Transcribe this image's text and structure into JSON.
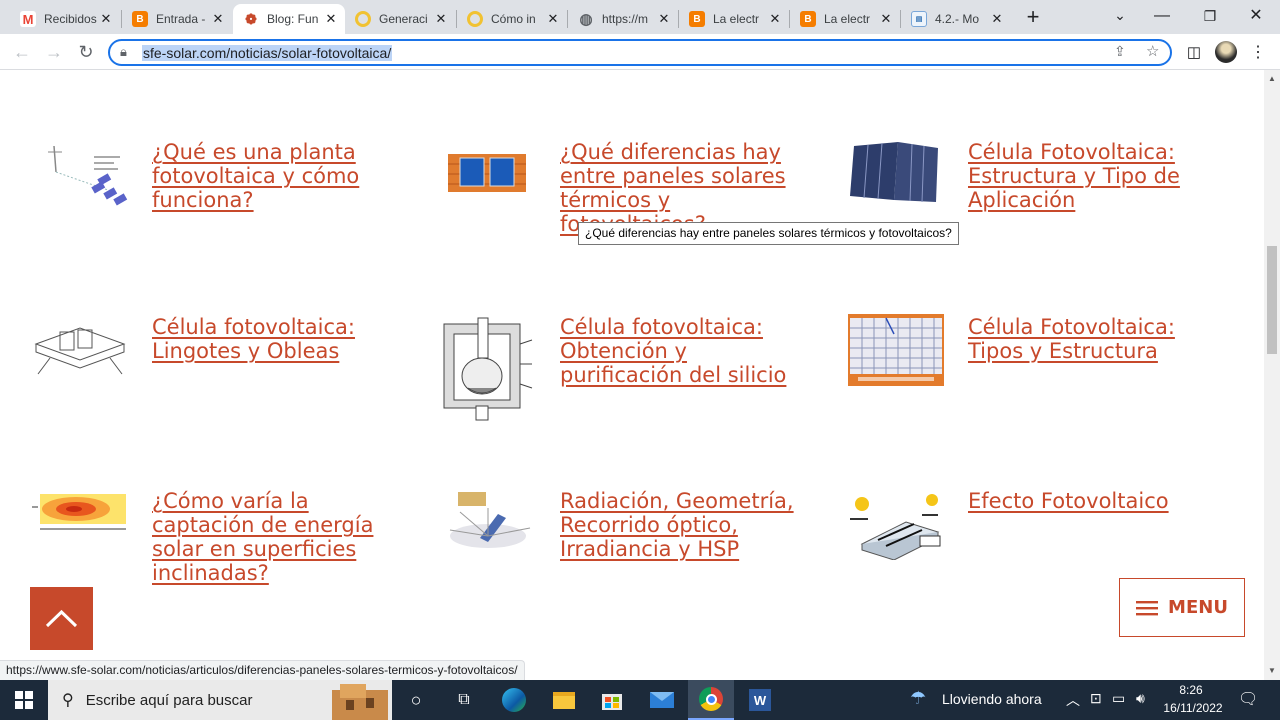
{
  "browser": {
    "tabs": [
      {
        "title": "Recibidos",
        "favicon": "gmail-icon",
        "active": false
      },
      {
        "title": "Entrada -",
        "favicon": "blogger-icon",
        "active": false
      },
      {
        "title": "Blog: Fun",
        "favicon": "sfe-solar-icon",
        "active": true
      },
      {
        "title": "Generaci",
        "favicon": "loading-icon",
        "active": false
      },
      {
        "title": "Cómo in",
        "favicon": "loading-icon",
        "active": false
      },
      {
        "title": "https://m",
        "favicon": "globe-icon",
        "active": false
      },
      {
        "title": "La electr",
        "favicon": "blogger-icon",
        "active": false
      },
      {
        "title": "La electr",
        "favicon": "blogger-icon",
        "active": false
      },
      {
        "title": "4.2.- Mo",
        "favicon": "doc-icon",
        "active": false
      }
    ],
    "url": "sfe-solar.com/noticias/solar-fotovoltaica/",
    "status_url": "https://www.sfe-solar.com/noticias/articulos/diferencias-paneles-solares-termicos-y-fotovoltaicos/"
  },
  "articles": [
    {
      "title": "¿Qué es una planta fotovoltaica y cómo funciona?"
    },
    {
      "title": "¿Qué diferencias hay entre paneles solares térmicos y fotovoltaicos?"
    },
    {
      "title": "Célula Fotovoltaica: Estructura y Tipo de Aplicación"
    },
    {
      "title": "Célula fotovoltaica: Lingotes y Obleas"
    },
    {
      "title": "Célula fotovoltaica: Obtención y purificación del silicio"
    },
    {
      "title": "Célula Fotovoltaica: Tipos y Estructura"
    },
    {
      "title": "¿Cómo varía la captación de energía solar en superficies inclinadas?"
    },
    {
      "title": "Radiación, Geometría, Recorrido óptico, Irradiancia y HSP"
    },
    {
      "title": "Efecto Fotovoltaico"
    }
  ],
  "tooltip": "¿Qué diferencias hay entre paneles solares térmicos y fotovoltaicos?",
  "menu_label": "MENU",
  "taskbar": {
    "search_placeholder": "Escribe aquí para buscar",
    "weather": "Lloviendo ahora",
    "time": "8:26",
    "date": "16/11/2022"
  },
  "colors": {
    "accent": "#c7492b",
    "taskbar": "#1c2a3a",
    "tab_strip": "#dee1e6"
  }
}
